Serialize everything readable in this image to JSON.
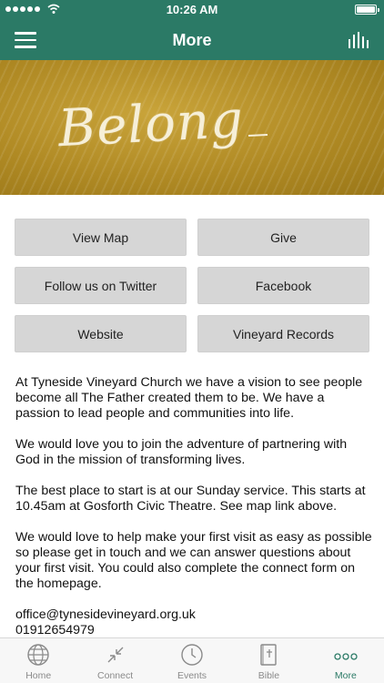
{
  "status_bar": {
    "time": "10:26 AM"
  },
  "nav": {
    "title": "More"
  },
  "banner": {
    "text": "Belong"
  },
  "buttons": [
    {
      "label": "View Map"
    },
    {
      "label": "Give"
    },
    {
      "label": "Follow us on Twitter"
    },
    {
      "label": "Facebook"
    },
    {
      "label": "Website"
    },
    {
      "label": "Vineyard Records"
    }
  ],
  "content": {
    "paragraphs": [
      "At Tyneside Vineyard Church we have a vision to see people become all The Father created them to be. We have a passion to lead people and communities into life.",
      "We would love you to join the adventure of partnering with God in the mission of transforming lives.",
      "The best place to start is at our Sunday service. This starts at 10.45am at Gosforth Civic Theatre. See map link above.",
      "We would love to help make your first visit as easy as possible so please get in touch and we can answer questions about your first visit. You could also complete the connect form on the homepage."
    ],
    "email": "office@tynesidevineyard.org.uk",
    "phone": "01912654979"
  },
  "tabs": [
    {
      "label": "Home",
      "icon": "globe-icon"
    },
    {
      "label": "Connect",
      "icon": "connect-arrows-icon"
    },
    {
      "label": "Events",
      "icon": "clock-icon"
    },
    {
      "label": "Bible",
      "icon": "bible-icon"
    },
    {
      "label": "More",
      "icon": "more-dots-icon",
      "active": true
    }
  ],
  "colors": {
    "accent": "#2b7a66",
    "button_bg": "#d6d6d6",
    "banner_gold": "#b08a24"
  }
}
